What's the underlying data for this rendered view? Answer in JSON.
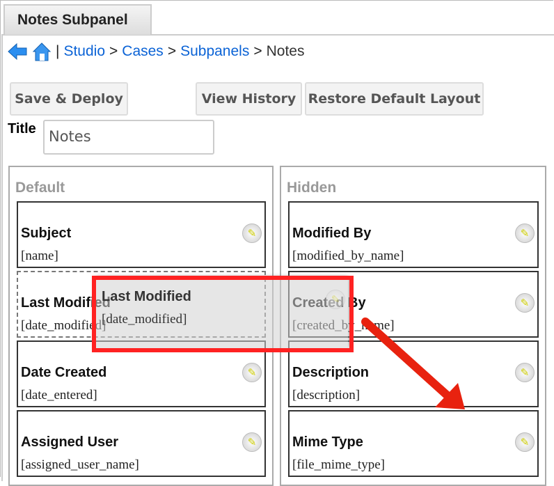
{
  "tab": {
    "label": "Notes Subpanel"
  },
  "breadcrumb": {
    "sep": "|",
    "items": [
      "Studio",
      "Cases",
      "Subpanels"
    ],
    "gt": ">",
    "current": "Notes"
  },
  "toolbar": {
    "save": "Save & Deploy",
    "history": "View History",
    "restore": "Restore Default Layout"
  },
  "title": {
    "label": "Title",
    "value": "Notes"
  },
  "default": {
    "heading": "Default",
    "items": [
      {
        "name": "Subject",
        "field": "[name]"
      },
      {
        "name": "Last Modified",
        "field": "[date_modified]"
      },
      {
        "name": "Date Created",
        "field": "[date_entered]"
      },
      {
        "name": "Assigned User",
        "field": "[assigned_user_name]"
      }
    ]
  },
  "hidden": {
    "heading": "Hidden",
    "items": [
      {
        "name": "Modified By",
        "field": "[modified_by_name]"
      },
      {
        "name": "Created By",
        "field": "[created_by_name]"
      },
      {
        "name": "Description",
        "field": "[description]"
      },
      {
        "name": "Mime Type",
        "field": "[file_mime_type]"
      }
    ]
  },
  "drag": {
    "name": "Last Modified",
    "field": "[date_modified]"
  },
  "icons": {
    "pencil": "✎"
  }
}
